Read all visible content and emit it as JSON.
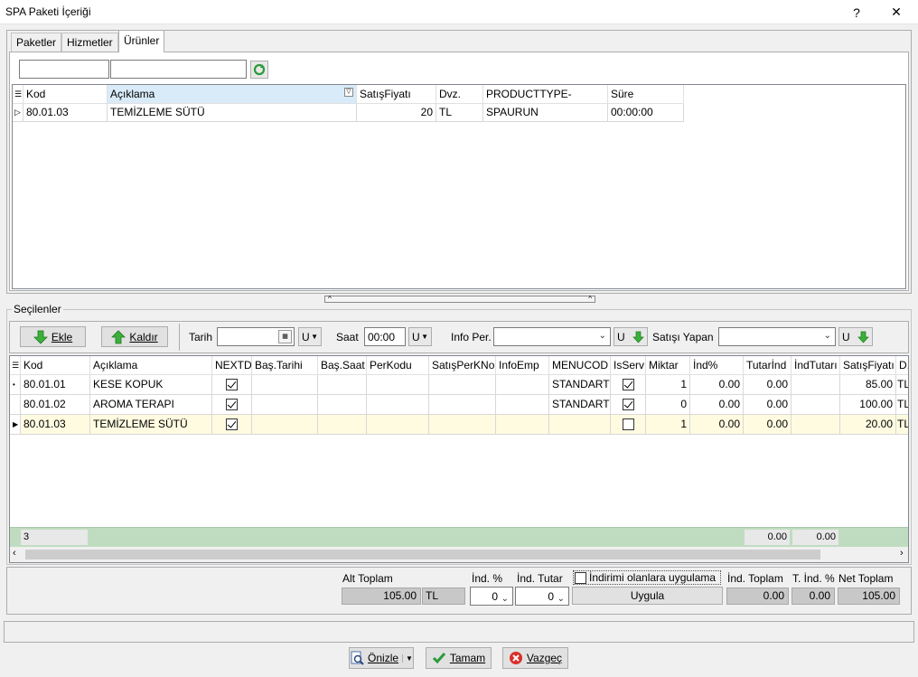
{
  "window": {
    "title": "SPA Paketi İçeriği",
    "help": "?",
    "close": "✕"
  },
  "tabs": [
    {
      "label": "Paketler"
    },
    {
      "label": "Hizmetler"
    },
    {
      "label": "Ürünler"
    }
  ],
  "top_grid": {
    "columns": [
      "Kod",
      "Açıklama",
      "SatışFiyatı",
      "Dvz.",
      "PRODUCTTYPE-",
      "Süre"
    ],
    "rows": [
      {
        "kod": "80.01.03",
        "aciklama": "TEMİZLEME SÜTÜ",
        "fiyat": "20",
        "dvz": "TL",
        "type": "SPAURUN",
        "sure": "00:00:00"
      }
    ]
  },
  "selected_section": {
    "label": "Seçilenler"
  },
  "toolbar": {
    "add": "Ekle",
    "remove": "Kaldır",
    "tarih_label": "Tarih",
    "saat_label": "Saat",
    "saat_value": "00:00",
    "info_per_label": "Info Per.",
    "satisi_yapan_label": "Satışı Yapan",
    "u": "U"
  },
  "bottom_grid": {
    "columns": [
      "Kod",
      "Açıklama",
      "NEXTD",
      "Baş.Tarihi",
      "Baş.Saat",
      "PerKodu",
      "SatışPerKNo",
      "InfoEmp",
      "MENUCOD",
      "IsServ",
      "Miktar",
      "İnd%",
      "Tutarİnd",
      "İndTutarı",
      "SatışFiyatı",
      "D."
    ],
    "rows": [
      {
        "kod": "80.01.01",
        "aciklama": "KESE KOPUK",
        "menucod": "STANDART",
        "miktar": "1",
        "ind": "0.00",
        "tutarind": "0.00",
        "fiyat": "85.00",
        "d": "TL"
      },
      {
        "kod": "80.01.02",
        "aciklama": "AROMA TERAPI",
        "menucod": "STANDART",
        "miktar": "0",
        "ind": "0.00",
        "tutarind": "0.00",
        "fiyat": "100.00",
        "d": "TL"
      },
      {
        "kod": "80.01.03",
        "aciklama": "TEMİZLEME SÜTÜ",
        "menucod": "",
        "miktar": "1",
        "ind": "0.00",
        "tutarind": "0.00",
        "fiyat": "20.00",
        "d": "TL"
      }
    ],
    "footer": {
      "count": "3",
      "tutarind_sum": "0.00",
      "indtutari_sum": "0.00"
    }
  },
  "totals": {
    "alt_toplam_label": "Alt Toplam",
    "alt_toplam_value": "105.00",
    "currency": "TL",
    "ind_pct_label": "İnd. %",
    "ind_pct_value": "0",
    "ind_tutar_label": "İnd. Tutar",
    "ind_tutar_value": "0",
    "apply_discount_label": "İndirimi olanlara uygulama",
    "apply_button": "Uygula",
    "ind_toplam_label": "İnd. Toplam",
    "ind_toplam_value": "0.00",
    "t_ind_label": "T. İnd. %",
    "t_ind_value": "0.00",
    "net_toplam_label": "Net Toplam",
    "net_toplam_value": "105.00"
  },
  "footer_buttons": {
    "preview": "Önizle",
    "ok": "Tamam",
    "cancel": "Vazgeç"
  }
}
